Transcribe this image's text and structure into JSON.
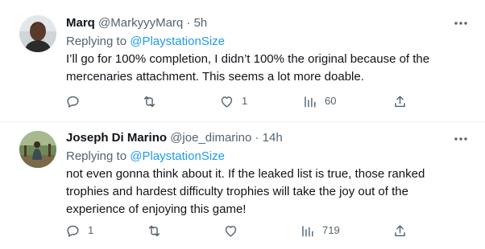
{
  "tweets": [
    {
      "display_name": "Marq",
      "handle": "@MarkyyyMarq",
      "separator": "·",
      "time": "5h",
      "replying_prefix": "Replying to",
      "replying_handle": "@PlaystationSize",
      "text": "I’ll go for 100% completion, I didn’t 100% the original because of  the mercenaries attachment. This seems a lot more doable.",
      "reply_count": "",
      "retweet_count": "",
      "like_count": "1",
      "view_count": "60"
    },
    {
      "display_name": "Joseph Di Marino",
      "handle": "@joe_dimarino",
      "separator": "·",
      "time": "14h",
      "replying_prefix": "Replying to",
      "replying_handle": "@PlaystationSize",
      "text": "not even gonna think about it. If the leaked list is true, those ranked trophies and hardest difficulty trophies will take the joy out of the experience of enjoying this game!",
      "reply_count": "1",
      "retweet_count": "",
      "like_count": "",
      "view_count": "719"
    }
  ],
  "icons": {
    "more": "more-horizontal-icon",
    "reply": "reply-icon",
    "retweet": "retweet-icon",
    "like": "heart-icon",
    "views": "views-icon",
    "share": "share-icon"
  },
  "colors": {
    "text_primary": "#0f1419",
    "text_secondary": "#536471",
    "link": "#1d9bf0",
    "divider": "#eff3f4"
  }
}
